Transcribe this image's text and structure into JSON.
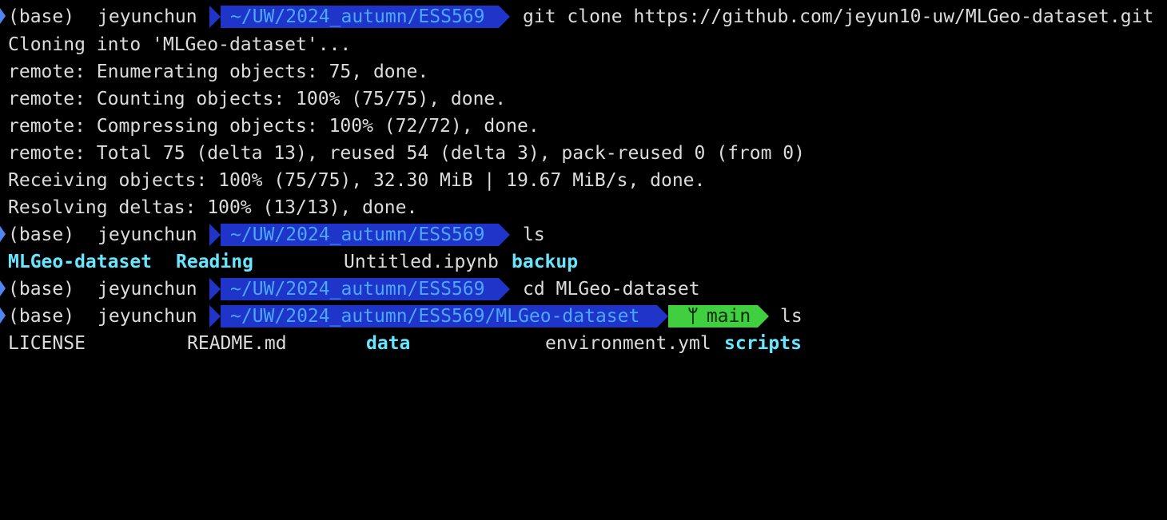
{
  "prompt": {
    "env": "(base)",
    "user": "jeyunchun",
    "cwd_repo_parent": "~/UW/2024_autumn/ESS569",
    "cwd_repo": "~/UW/2024_autumn/ESS569/MLGeo-dataset",
    "branch": "main"
  },
  "commands": {
    "clone": "git clone https://github.com/jeyun10-uw/MLGeo-dataset.git",
    "ls1": "ls",
    "cd": "cd MLGeo-dataset",
    "ls2": "ls"
  },
  "clone_output": [
    "Cloning into 'MLGeo-dataset'...",
    "remote: Enumerating objects: 75, done.",
    "remote: Counting objects: 100% (75/75), done.",
    "remote: Compressing objects: 100% (72/72), done.",
    "remote: Total 75 (delta 13), reused 54 (delta 3), pack-reused 0 (from 0)",
    "Receiving objects: 100% (75/75), 32.30 MiB | 19.67 MiB/s, done.",
    "Resolving deltas: 100% (13/13), done."
  ],
  "ls1_output": {
    "dir1": "MLGeo-dataset",
    "dir2": "Reading",
    "file1": "Untitled.ipynb",
    "dir3": "backup"
  },
  "ls2_output": {
    "file1": "LICENSE",
    "file2": "README.md",
    "dir1": "data",
    "file3": "environment.yml",
    "dir2": "scripts"
  },
  "colors": {
    "background": "#000000",
    "text": "#dcdcdc",
    "dir_segment_bg": "#1f34c8",
    "dir_segment_fg": "#4aa8ff",
    "git_segment_bg": "#3fcf3f",
    "directory_listing": "#66e6ff",
    "prompt_marker": "#4f86f7"
  }
}
